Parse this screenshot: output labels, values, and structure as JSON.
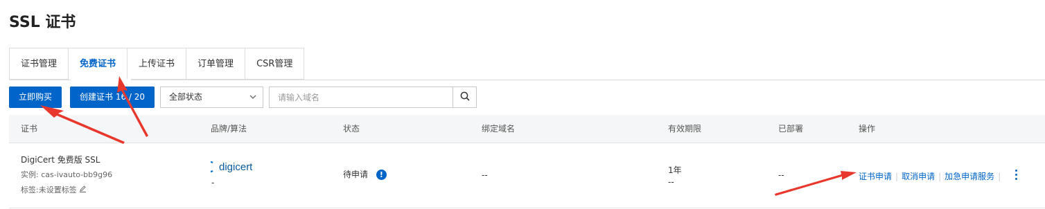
{
  "page": {
    "title": "SSL 证书"
  },
  "tabs": [
    {
      "label": "证书管理"
    },
    {
      "label": "免费证书",
      "active": true
    },
    {
      "label": "上传证书"
    },
    {
      "label": "订单管理"
    },
    {
      "label": "CSR管理"
    }
  ],
  "toolbar": {
    "buy_label": "立即购买",
    "create_label": "创建证书 16 / 20",
    "status_filter": "全部状态",
    "search_placeholder": "请输入域名"
  },
  "table": {
    "columns": [
      "证书",
      "品牌/算法",
      "状态",
      "绑定域名",
      "有效期限",
      "已部署",
      "操作"
    ],
    "rows": [
      {
        "name": "DigiCert 免费版 SSL",
        "instance": "实例: cas-ivauto-bb9g96",
        "tags": "标签:未设置标签",
        "brand_logo": "digicert",
        "brand_sub": "-",
        "status": "待申请",
        "domain": "--",
        "validity": "1年",
        "validity_sub": "--",
        "deployed": "--",
        "actions": [
          "证书申请",
          "取消申请",
          "加急申请服务"
        ]
      }
    ]
  },
  "colors": {
    "accent": "#0064c8",
    "arrow": "#e8372c"
  }
}
